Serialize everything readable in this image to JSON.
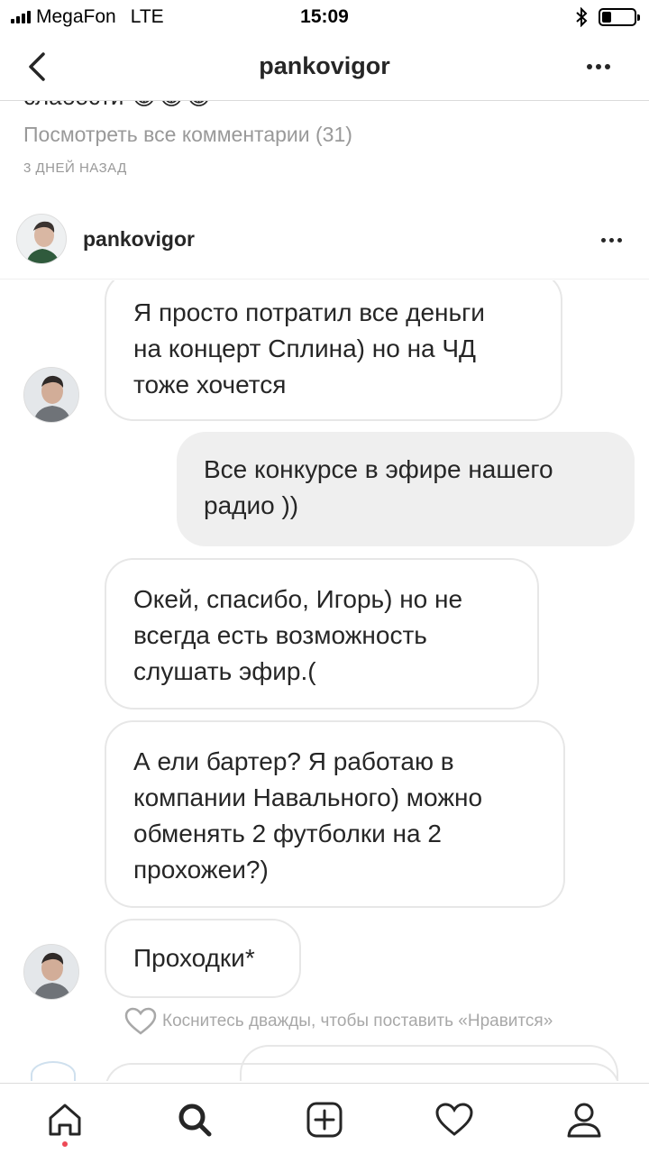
{
  "status_bar": {
    "carrier": "MegaFon",
    "network": "LTE",
    "time": "15:09",
    "battery_level": 0.3
  },
  "header": {
    "title": "pankovigor",
    "back_icon": "chevron-left-icon",
    "more_icon": "more-horizontal-icon"
  },
  "previous_post": {
    "caption_tail": "слабости 😂😂😂",
    "view_comments": "Посмотреть все комментарии (31)",
    "time_ago": "3 ДНЕЙ НАЗАД"
  },
  "post": {
    "username": "pankovigor",
    "more_icon": "more-horizontal-icon"
  },
  "chat": {
    "messages": [
      {
        "side": "in",
        "lines": [
          "Я просто потратил все деньги",
          "на концерт Сплина) но на ЧД",
          "тоже хочется"
        ]
      },
      {
        "side": "out",
        "lines": [
          "Все конкурсе в эфире нашего",
          "радио ))"
        ]
      },
      {
        "side": "in",
        "lines": [
          "Окей, спасибо, Игорь) но не",
          "всегда есть возможность",
          "слушать эфир.("
        ]
      },
      {
        "side": "in",
        "lines": [
          "А ели бартер? Я работаю в",
          "компании Навального) можно",
          "обменять 2 футболки на 2",
          "прохожеи?)"
        ]
      },
      {
        "side": "in",
        "lines": [
          "Проходки*"
        ]
      }
    ],
    "like_hint": "Коснитесь дважды, чтобы поставить «Нравится»"
  },
  "tabbar": {
    "items": [
      {
        "name": "home-icon"
      },
      {
        "name": "search-icon"
      },
      {
        "name": "add-post-icon"
      },
      {
        "name": "heart-icon"
      },
      {
        "name": "profile-icon"
      }
    ],
    "active": "home-icon",
    "accent": "#ed4956"
  }
}
